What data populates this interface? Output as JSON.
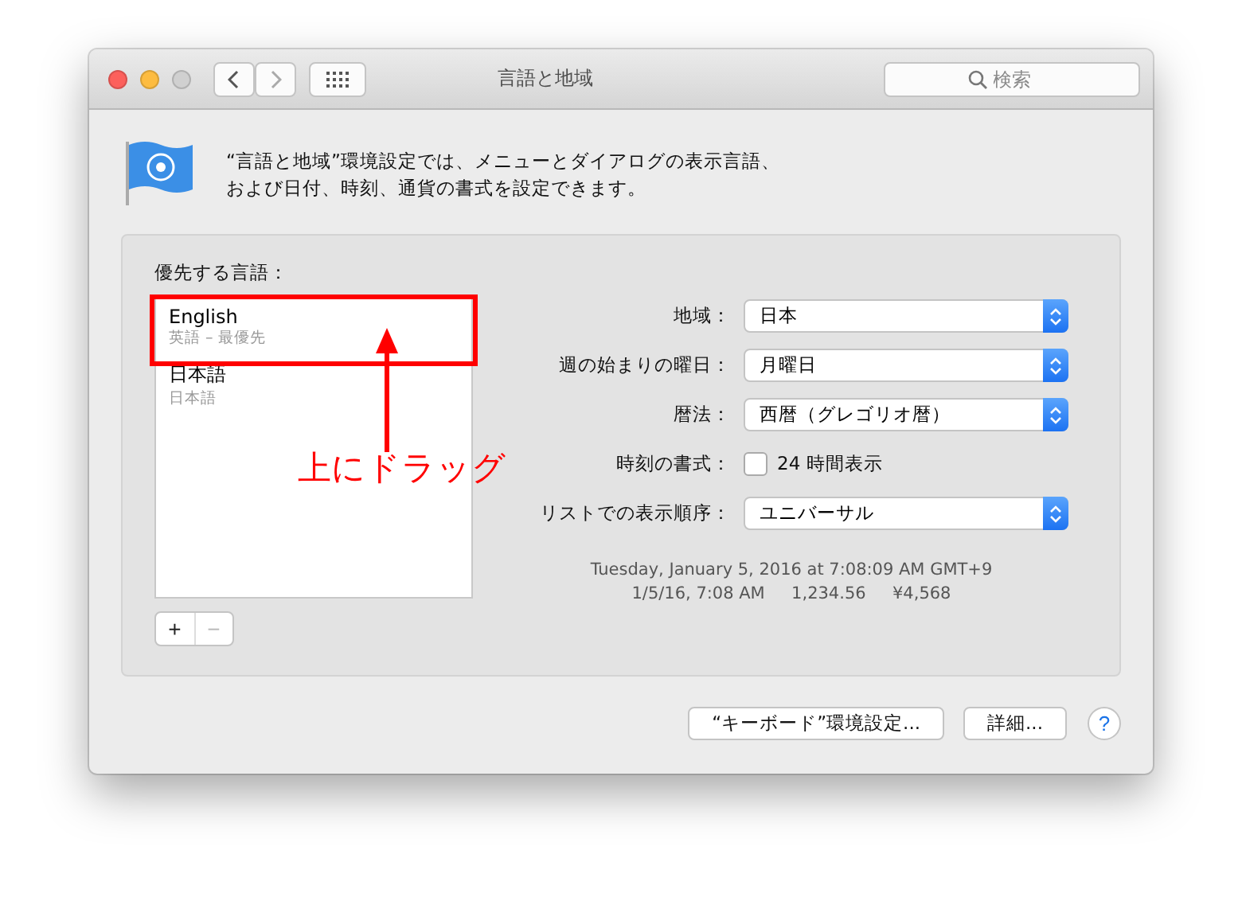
{
  "window": {
    "title": "言語と地域"
  },
  "search": {
    "placeholder": "検索"
  },
  "description": [
    "“言語と地域”環境設定では、メニューとダイアログの表示言語、",
    "および日付、時刻、通貨の書式を設定できます。"
  ],
  "preferred_languages": {
    "label": "優先する言語：",
    "items": [
      {
        "name": "English",
        "subtitle": "英語 – 最優先"
      },
      {
        "name": "日本語",
        "subtitle": "日本語"
      }
    ],
    "add_button": "+",
    "remove_button": "−"
  },
  "settings": [
    {
      "kind": "popup",
      "label": "地域：",
      "value": "日本"
    },
    {
      "kind": "popup",
      "label": "週の始まりの曜日：",
      "value": "月曜日"
    },
    {
      "kind": "popup",
      "label": "暦法：",
      "value": "西暦（グレゴリオ暦）"
    },
    {
      "kind": "checkbox",
      "label": "時刻の書式：",
      "value": "24 時間表示",
      "checked": false
    },
    {
      "kind": "popup",
      "label": "リストでの表示順序：",
      "value": "ユニバーサル"
    }
  ],
  "preview": [
    "Tuesday, January 5, 2016 at 7:08:09 AM GMT+9",
    "1/5/16, 7:08 AM     1,234.56     ¥4,568"
  ],
  "buttons": [
    "“キーボード”環境設定...",
    "詳細..."
  ],
  "help_button": "?",
  "annotation": {
    "text": "上にドラッグ"
  }
}
